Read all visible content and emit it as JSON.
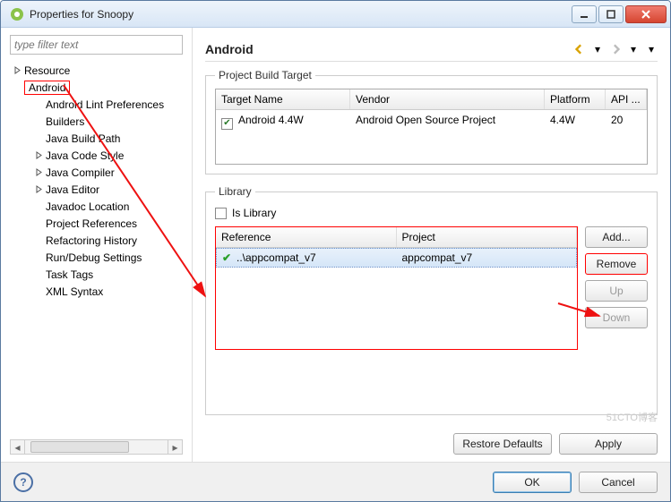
{
  "window": {
    "title": "Properties for Snoopy"
  },
  "sidebar": {
    "filter_placeholder": "type filter text",
    "items": [
      {
        "label": "Resource",
        "expandable": true
      },
      {
        "label": "Android",
        "expandable": false,
        "selected": true
      },
      {
        "label": "Android Lint Preferences",
        "expandable": false,
        "child": true
      },
      {
        "label": "Builders",
        "expandable": false,
        "child": true
      },
      {
        "label": "Java Build Path",
        "expandable": false,
        "child": true
      },
      {
        "label": "Java Code Style",
        "expandable": true,
        "child": true
      },
      {
        "label": "Java Compiler",
        "expandable": true,
        "child": true
      },
      {
        "label": "Java Editor",
        "expandable": true,
        "child": true
      },
      {
        "label": "Javadoc Location",
        "expandable": false,
        "child": true
      },
      {
        "label": "Project References",
        "expandable": false,
        "child": true
      },
      {
        "label": "Refactoring History",
        "expandable": false,
        "child": true
      },
      {
        "label": "Run/Debug Settings",
        "expandable": false,
        "child": true
      },
      {
        "label": "Task Tags",
        "expandable": false,
        "child": true
      },
      {
        "label": "XML Syntax",
        "expandable": false,
        "child": true
      }
    ]
  },
  "main": {
    "heading": "Android",
    "build_target": {
      "legend": "Project Build Target",
      "columns": {
        "name": "Target Name",
        "vendor": "Vendor",
        "platform": "Platform",
        "api": "API ..."
      },
      "row": {
        "checked": true,
        "name": "Android 4.4W",
        "vendor": "Android Open Source Project",
        "platform": "4.4W",
        "api": "20"
      }
    },
    "library": {
      "legend": "Library",
      "is_library_label": "Is Library",
      "is_library_checked": false,
      "columns": {
        "reference": "Reference",
        "project": "Project"
      },
      "row": {
        "reference": "..\\appcompat_v7",
        "project": "appcompat_v7"
      },
      "buttons": {
        "add": "Add...",
        "remove": "Remove",
        "up": "Up",
        "down": "Down"
      }
    },
    "bottom": {
      "restore": "Restore Defaults",
      "apply": "Apply"
    }
  },
  "footer": {
    "ok": "OK",
    "cancel": "Cancel"
  },
  "watermark": "51CTO博客"
}
